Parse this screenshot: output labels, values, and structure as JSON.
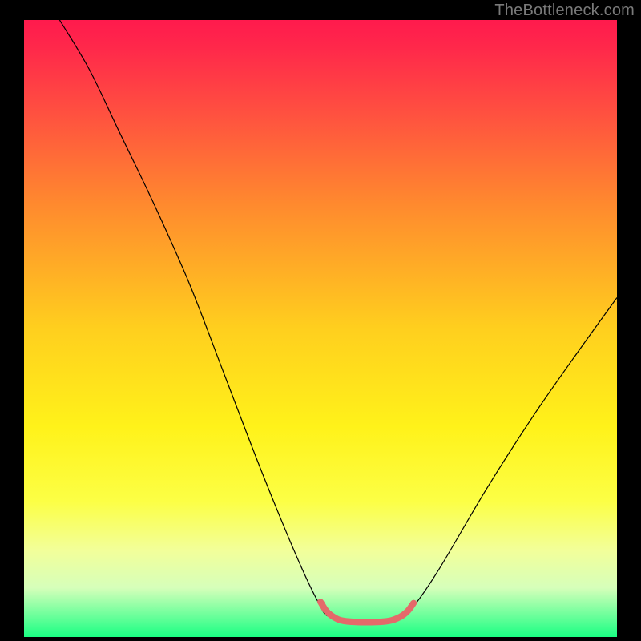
{
  "watermark": "TheBottleneck.com",
  "chart_data": {
    "type": "line",
    "title": "",
    "xlabel": "",
    "ylabel": "",
    "xrange": [
      0,
      100
    ],
    "yrange": [
      0,
      100
    ],
    "gradient_stops": [
      {
        "pos": 0.0,
        "color": "#ff1a4d"
      },
      {
        "pos": 0.05,
        "color": "#ff2a4a"
      },
      {
        "pos": 0.15,
        "color": "#ff5040"
      },
      {
        "pos": 0.3,
        "color": "#ff8a2e"
      },
      {
        "pos": 0.5,
        "color": "#ffcf1e"
      },
      {
        "pos": 0.66,
        "color": "#fff21a"
      },
      {
        "pos": 0.78,
        "color": "#fcff45"
      },
      {
        "pos": 0.86,
        "color": "#f2ff9a"
      },
      {
        "pos": 0.92,
        "color": "#d6ffba"
      },
      {
        "pos": 1.0,
        "color": "#1aff83"
      }
    ],
    "series": [
      {
        "name": "bottleneck-curve",
        "color": "#000000",
        "width": 1.2,
        "points": [
          {
            "x": 6.0,
            "y": 100.0
          },
          {
            "x": 11.0,
            "y": 92.0
          },
          {
            "x": 16.0,
            "y": 82.0
          },
          {
            "x": 22.0,
            "y": 70.0
          },
          {
            "x": 28.0,
            "y": 57.0
          },
          {
            "x": 34.0,
            "y": 42.0
          },
          {
            "x": 40.0,
            "y": 27.0
          },
          {
            "x": 46.0,
            "y": 13.0
          },
          {
            "x": 49.7,
            "y": 5.5
          },
          {
            "x": 51.7,
            "y": 3.2
          },
          {
            "x": 57.5,
            "y": 2.4
          },
          {
            "x": 63.0,
            "y": 3.0
          },
          {
            "x": 65.7,
            "y": 5.0
          },
          {
            "x": 70.0,
            "y": 11.0
          },
          {
            "x": 78.0,
            "y": 24.0
          },
          {
            "x": 86.0,
            "y": 36.0
          },
          {
            "x": 94.0,
            "y": 47.0
          },
          {
            "x": 100.0,
            "y": 55.0
          }
        ]
      },
      {
        "name": "optimal-band",
        "color": "#e46a6a",
        "width": 8,
        "points": [
          {
            "x": 50.0,
            "y": 5.7
          },
          {
            "x": 51.0,
            "y": 4.2
          },
          {
            "x": 52.3,
            "y": 3.2
          },
          {
            "x": 54.0,
            "y": 2.6
          },
          {
            "x": 58.0,
            "y": 2.4
          },
          {
            "x": 61.5,
            "y": 2.6
          },
          {
            "x": 63.5,
            "y": 3.3
          },
          {
            "x": 64.7,
            "y": 4.2
          },
          {
            "x": 65.7,
            "y": 5.5
          }
        ]
      }
    ]
  }
}
